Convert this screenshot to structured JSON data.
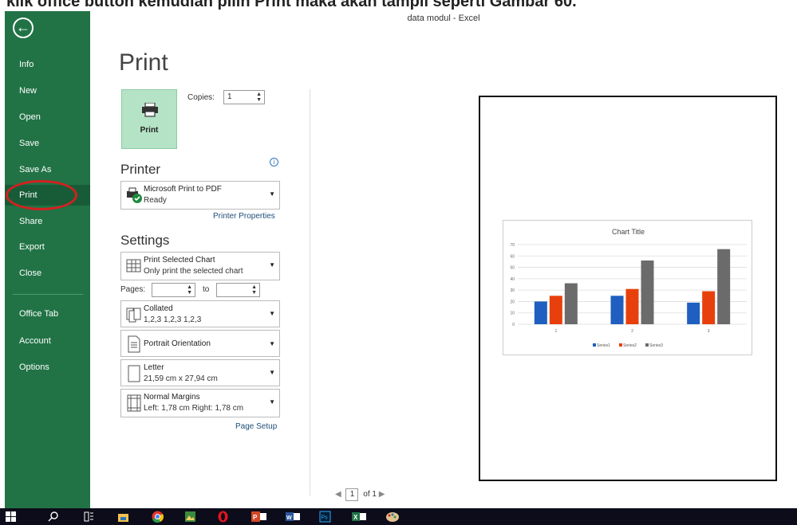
{
  "caption_text": "klik office button kemudian pilih Print maka akan tampil seperti Gambar 60.",
  "window_title": "data modul - Excel",
  "nav": {
    "items": [
      "Info",
      "New",
      "Open",
      "Save",
      "Save As",
      "Print",
      "Share",
      "Export",
      "Close",
      "Office Tab",
      "Account",
      "Options"
    ],
    "selected": "Print"
  },
  "page_title": "Print",
  "print_button_label": "Print",
  "copies": {
    "label": "Copies:",
    "value": "1"
  },
  "printer": {
    "section_title": "Printer",
    "name": "Microsoft Print to PDF",
    "status": "Ready",
    "properties_link": "Printer Properties"
  },
  "settings": {
    "section_title": "Settings",
    "print_what": {
      "title": "Print Selected Chart",
      "subtitle": "Only print the selected chart"
    },
    "pages_label": "Pages:",
    "to_label": "to",
    "collation": {
      "title": "Collated",
      "subtitle": "1,2,3   1,2,3   1,2,3"
    },
    "orientation": "Portrait Orientation",
    "paper": {
      "title": "Letter",
      "subtitle": "21,59 cm x 27,94 cm"
    },
    "margins": {
      "title": "Normal Margins",
      "subtitle": "Left:  1,78 cm   Right:  1,78 cm"
    },
    "page_setup_link": "Page Setup"
  },
  "pager": {
    "current": "1",
    "total_label": "of 1"
  },
  "accent_color": "#217346",
  "chart_data": {
    "type": "bar",
    "title": "Chart Title",
    "categories": [
      "1",
      "2",
      "3"
    ],
    "series": [
      {
        "name": "Series1",
        "values": [
          20,
          25,
          19
        ],
        "color": "#1f5fbf"
      },
      {
        "name": "Series2",
        "values": [
          25,
          31,
          29
        ],
        "color": "#e8400c"
      },
      {
        "name": "Series3",
        "values": [
          36,
          56,
          66
        ],
        "color": "#6b6b6b"
      }
    ],
    "ylim": [
      0,
      70
    ],
    "yticks": [
      "0",
      "10",
      "20",
      "30",
      "40",
      "50",
      "60",
      "70"
    ],
    "legend": "bottom",
    "grid": true
  },
  "taskbar_icons": [
    "windows-icon",
    "search-icon",
    "task-view-icon",
    "file-explorer-icon",
    "chrome-icon",
    "photo-app-icon",
    "opera-icon",
    "powerpoint-icon",
    "word-icon",
    "photoshop-icon",
    "excel-icon",
    "paint-icon"
  ]
}
